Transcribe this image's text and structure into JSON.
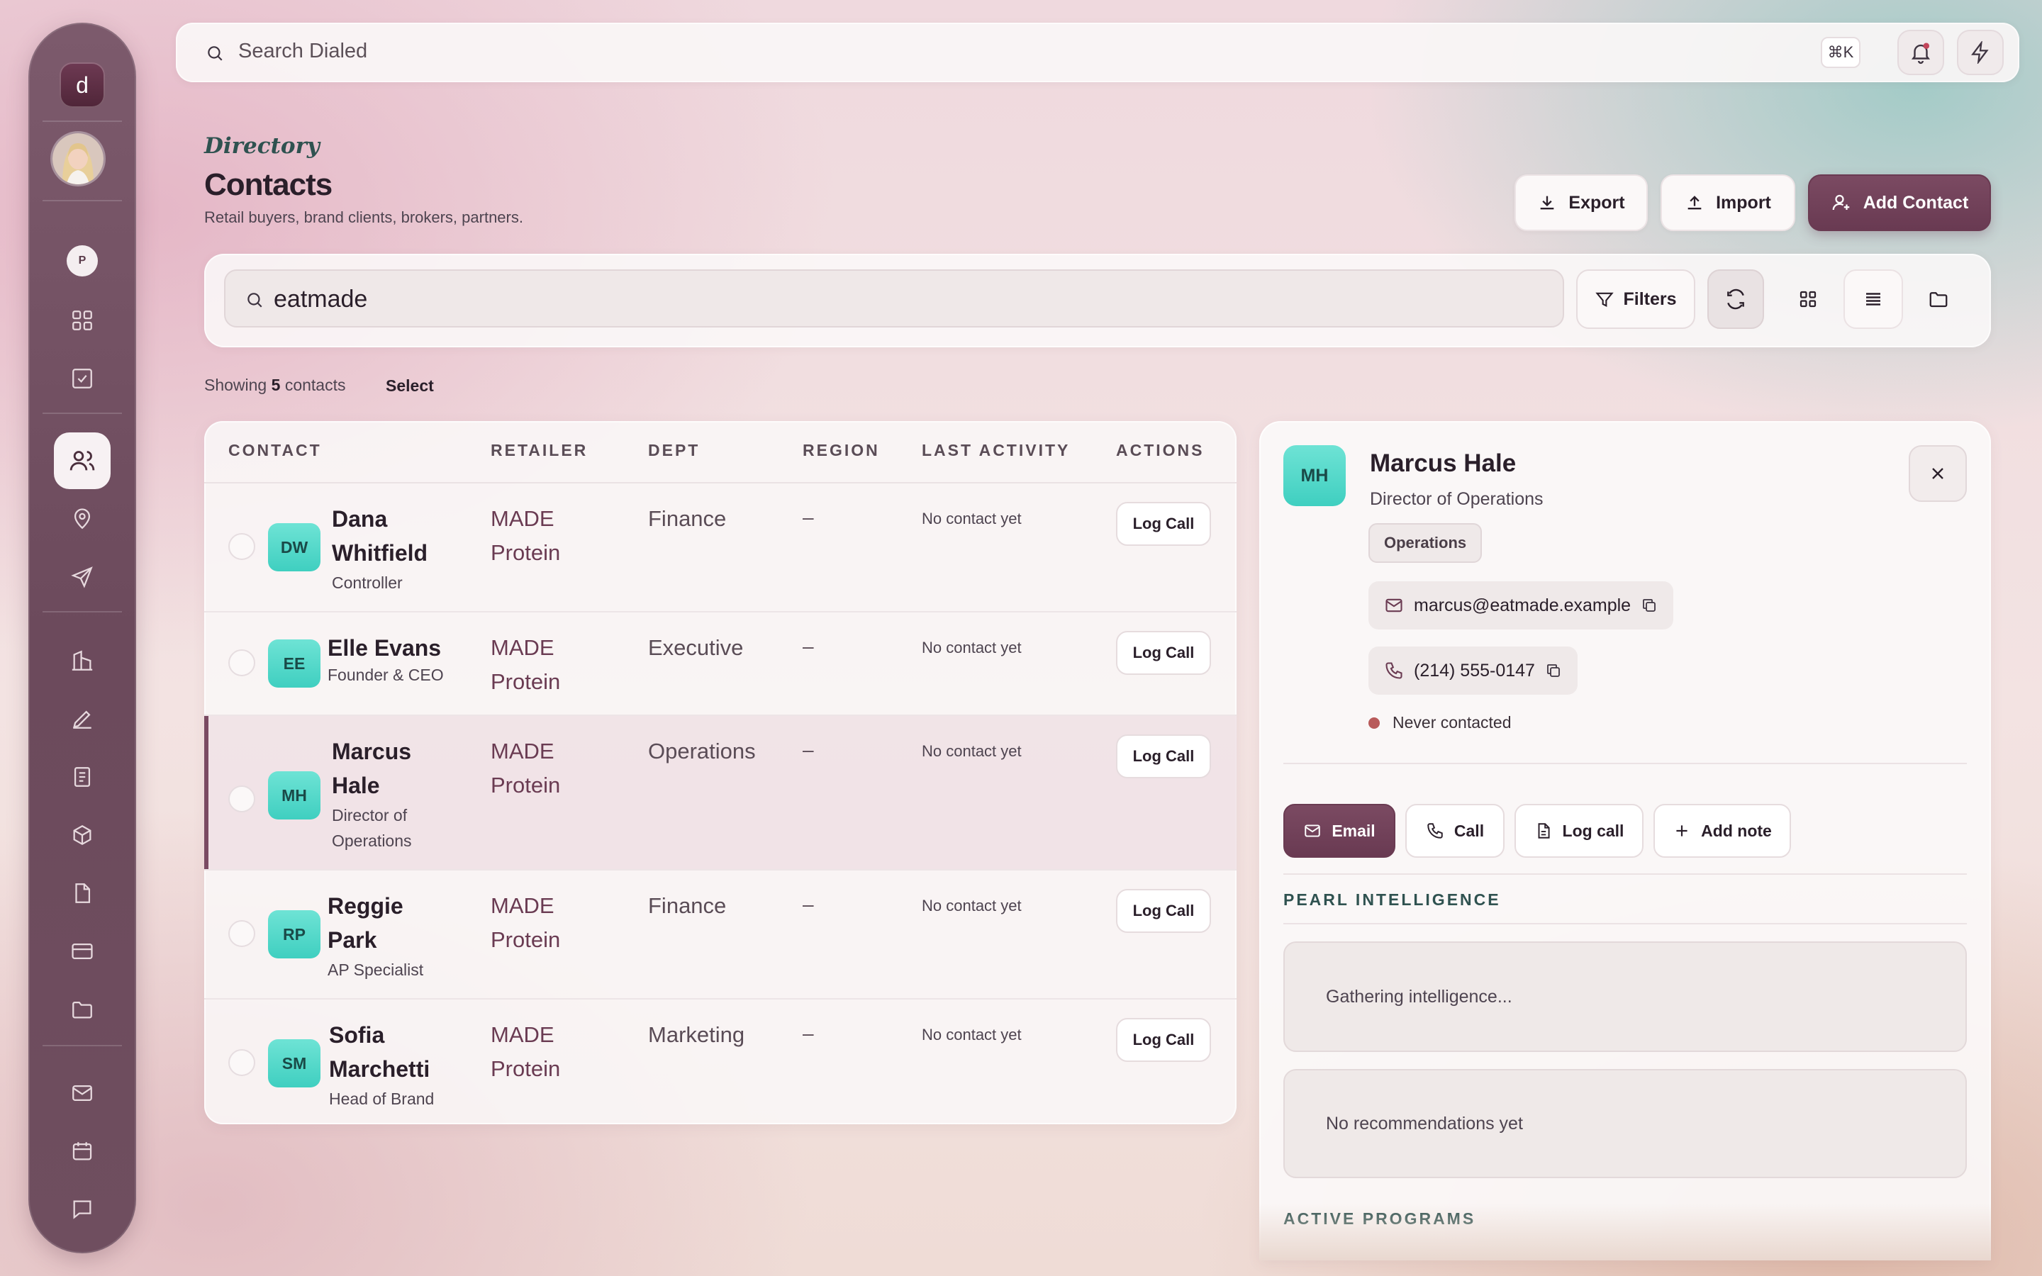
{
  "sidebar": {
    "logo": "d",
    "workspace_badge": "P"
  },
  "topbar": {
    "search_placeholder": "Search Dialed",
    "shortcut": "⌘K"
  },
  "header": {
    "eyebrow": "Directory",
    "title": "Contacts",
    "subtitle": "Retail buyers, brand clients, brokers, partners.",
    "export_label": "Export",
    "import_label": "Import",
    "add_label": "Add Contact"
  },
  "filters": {
    "search_value": "eatmade",
    "filters_label": "Filters"
  },
  "summary": {
    "prefix": "Showing",
    "count": "5",
    "suffix": "contacts",
    "select_label": "Select"
  },
  "table": {
    "columns": [
      "CONTACT",
      "RETAILER",
      "DEPT",
      "REGION",
      "LAST ACTIVITY",
      "ACTIONS"
    ],
    "rows": [
      {
        "initials": "DW",
        "name": "Dana Whitfield",
        "title": "Controller",
        "retailer": "MADE Protein",
        "dept": "Finance",
        "region": "–",
        "last_activity": "No contact yet",
        "action": "Log Call"
      },
      {
        "initials": "EE",
        "name": "Elle Evans",
        "title": "Founder & CEO",
        "retailer": "MADE Protein",
        "dept": "Executive",
        "region": "–",
        "last_activity": "No contact yet",
        "action": "Log Call"
      },
      {
        "initials": "MH",
        "name": "Marcus Hale",
        "title": "Director of Operations",
        "retailer": "MADE Protein",
        "dept": "Operations",
        "region": "–",
        "last_activity": "No contact yet",
        "action": "Log Call"
      },
      {
        "initials": "RP",
        "name": "Reggie Park",
        "title": "AP Specialist",
        "retailer": "MADE Protein",
        "dept": "Finance",
        "region": "–",
        "last_activity": "No contact yet",
        "action": "Log Call"
      },
      {
        "initials": "SM",
        "name": "Sofia Marchetti",
        "title": "Head of Brand",
        "retailer": "MADE Protein",
        "dept": "Marketing",
        "region": "–",
        "last_activity": "No contact yet",
        "action": "Log Call"
      }
    ]
  },
  "detail": {
    "initials": "MH",
    "name": "Marcus Hale",
    "role": "Director of Operations",
    "tag": "Operations",
    "email": "marcus@eatmade.example",
    "phone": "(214) 555-0147",
    "status": "Never contacted",
    "actions": {
      "email": "Email",
      "call": "Call",
      "log_call": "Log call",
      "add_note": "Add note"
    },
    "intel_title": "PEARL INTELLIGENCE",
    "intel_loading": "Gathering intelligence...",
    "recommendations": "No recommendations yet",
    "programs_title": "ACTIVE PROGRAMS"
  },
  "colors": {
    "accent": "#6a3b52",
    "teal_avatar": "#4fd8c9",
    "status_dot": "#b85a5a",
    "section_title": "#2f5250"
  }
}
